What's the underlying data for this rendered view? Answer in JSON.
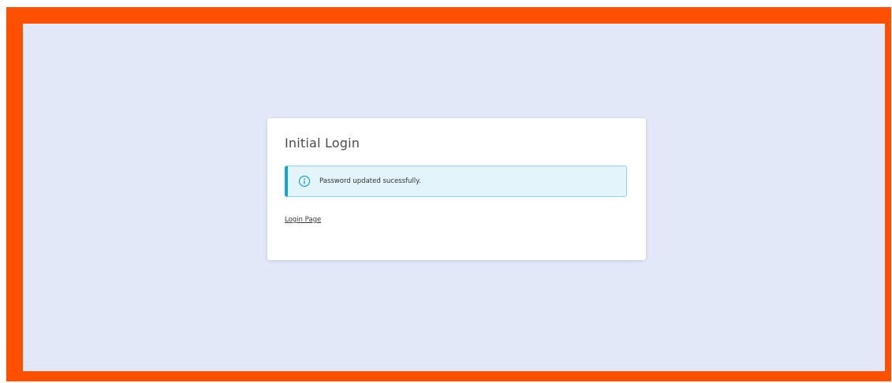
{
  "card": {
    "title": "Initial Login",
    "alert": {
      "icon": "info-circle-icon",
      "message": "Password updated sucessfully.",
      "accent_color": "#15a3d8",
      "background_color": "#e4f4fb"
    },
    "link_label": "Login Page"
  },
  "colors": {
    "frame": "#fe5000",
    "page_background": "#e2e8f7",
    "card_background": "#ffffff"
  }
}
